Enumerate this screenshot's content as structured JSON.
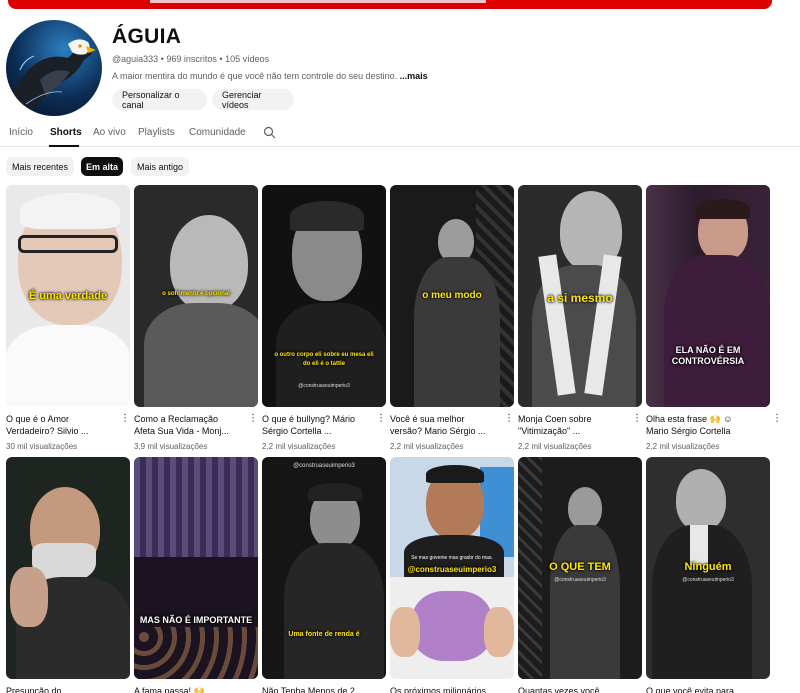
{
  "channel": {
    "name": "ÁGUIA",
    "handle": "@aguia333",
    "subscribers": "969 inscritos",
    "videos": "105 vídeos",
    "description": "A maior mentira do mundo é que você não tem controle do seu destino. ",
    "more": "...mais",
    "customize_label": "Personalizar o canal",
    "manage_label": "Gerenciar vídeos"
  },
  "tabs": [
    "Início",
    "Shorts",
    "Ao vivo",
    "Playlists",
    "Comunidade"
  ],
  "active_tab": "Shorts",
  "filters": [
    "Mais recentes",
    "Em alta",
    "Mais antigo"
  ],
  "active_filter": "Em alta",
  "separator": "•",
  "shorts": [
    {
      "title_line1": "O que é o Amor",
      "title_line2": "Verdadeiro? Silvio ...",
      "views": "30 mil visualizações",
      "caption": "É uma verdade"
    },
    {
      "title_line1": "Como a Reclamação",
      "title_line2": "Afeta Sua Vida - Monj...",
      "views": "3,9 mil visualizações",
      "caption": "o sofrimento é opcional"
    },
    {
      "title_line1": "O que é bullyng? Mário",
      "title_line2": "Sérgio Cortella ...",
      "views": "2,2 mil visualizações",
      "caption": "o outro corpo eli sobre eu mesa eli do eli é o tattie"
    },
    {
      "title_line1": "Você é sua melhor",
      "title_line2": "versão? Mario Sérgio ...",
      "views": "2,2 mil visualizações",
      "caption": "o meu modo"
    },
    {
      "title_line1": "Monja Coen sobre",
      "title_line2": "\"Vitimização\" ...",
      "views": "2,2 mil visualizações",
      "caption": "a si mesmo"
    },
    {
      "title_line1": "Olha esta frase 🙌 ☺",
      "title_line2": "Mario Sérgio Cortella",
      "views": "2,2 mil visualizações",
      "caption": "ELA NÃO É EM CONTROVÉRSIA"
    },
    {
      "title_line1": "Presunção do",
      "caption": ""
    },
    {
      "title_line1": "A fama passa! 🙌",
      "caption": "MAS NÃO É IMPORTANTE"
    },
    {
      "title_line1": "Não Tenha Menos de 2",
      "caption": "Uma fonte de renda é",
      "watermark": "@construaseuimperio3"
    },
    {
      "title_line1": "Os próximos milionários",
      "caption": "@construaseuimperio3",
      "subtext": "Se mas goveme mas grasbr do mas."
    },
    {
      "title_line1": "Quantas vezes você",
      "caption": "O QUE TEM"
    },
    {
      "title_line1": "O que você evita para",
      "caption": "Ninguém"
    }
  ],
  "watermarks": {
    "w1": "@construaseuimperio3",
    "w2": "@construaseuimperio3",
    "w3": "@construaseuimperio3",
    "w4": "@construaseuimperio3"
  },
  "colors": {
    "brand_red": "#dd0000",
    "caption_yellow": "#ffe600",
    "active_chip": "#0f0f0f"
  }
}
